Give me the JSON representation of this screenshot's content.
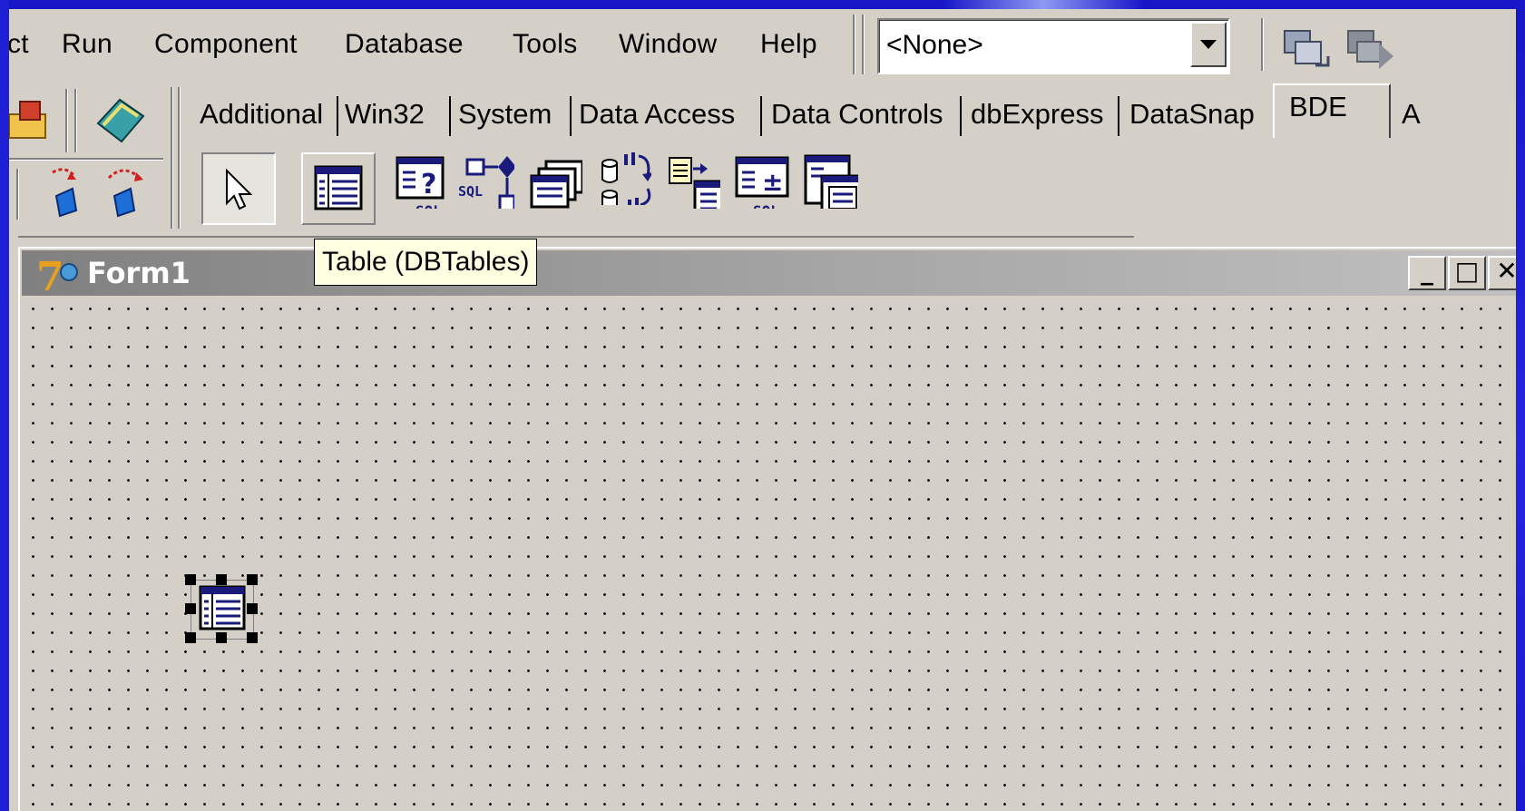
{
  "menu": {
    "items": [
      "ct",
      "Run",
      "Component",
      "Database",
      "Tools",
      "Window",
      "Help"
    ]
  },
  "combo": {
    "value": "<None>"
  },
  "palette": {
    "tabs": [
      "Additional",
      "Win32",
      "System",
      "Data Access",
      "Data Controls",
      "dbExpress",
      "DataSnap",
      "BDE",
      "A"
    ],
    "active_tab": "BDE",
    "sql_label": "SQL"
  },
  "tooltip": {
    "text": "Table (DBTables)"
  },
  "form": {
    "title": "Form1",
    "logo_text": "7",
    "minimize": "_",
    "maximize": "□",
    "close": "✕"
  },
  "colors": {
    "slide_background": "#1f1fd6",
    "ide_face": "#d4d0c8",
    "tooltip_bg": "#ffffe1",
    "icon_navy": "#1a1a7a"
  }
}
